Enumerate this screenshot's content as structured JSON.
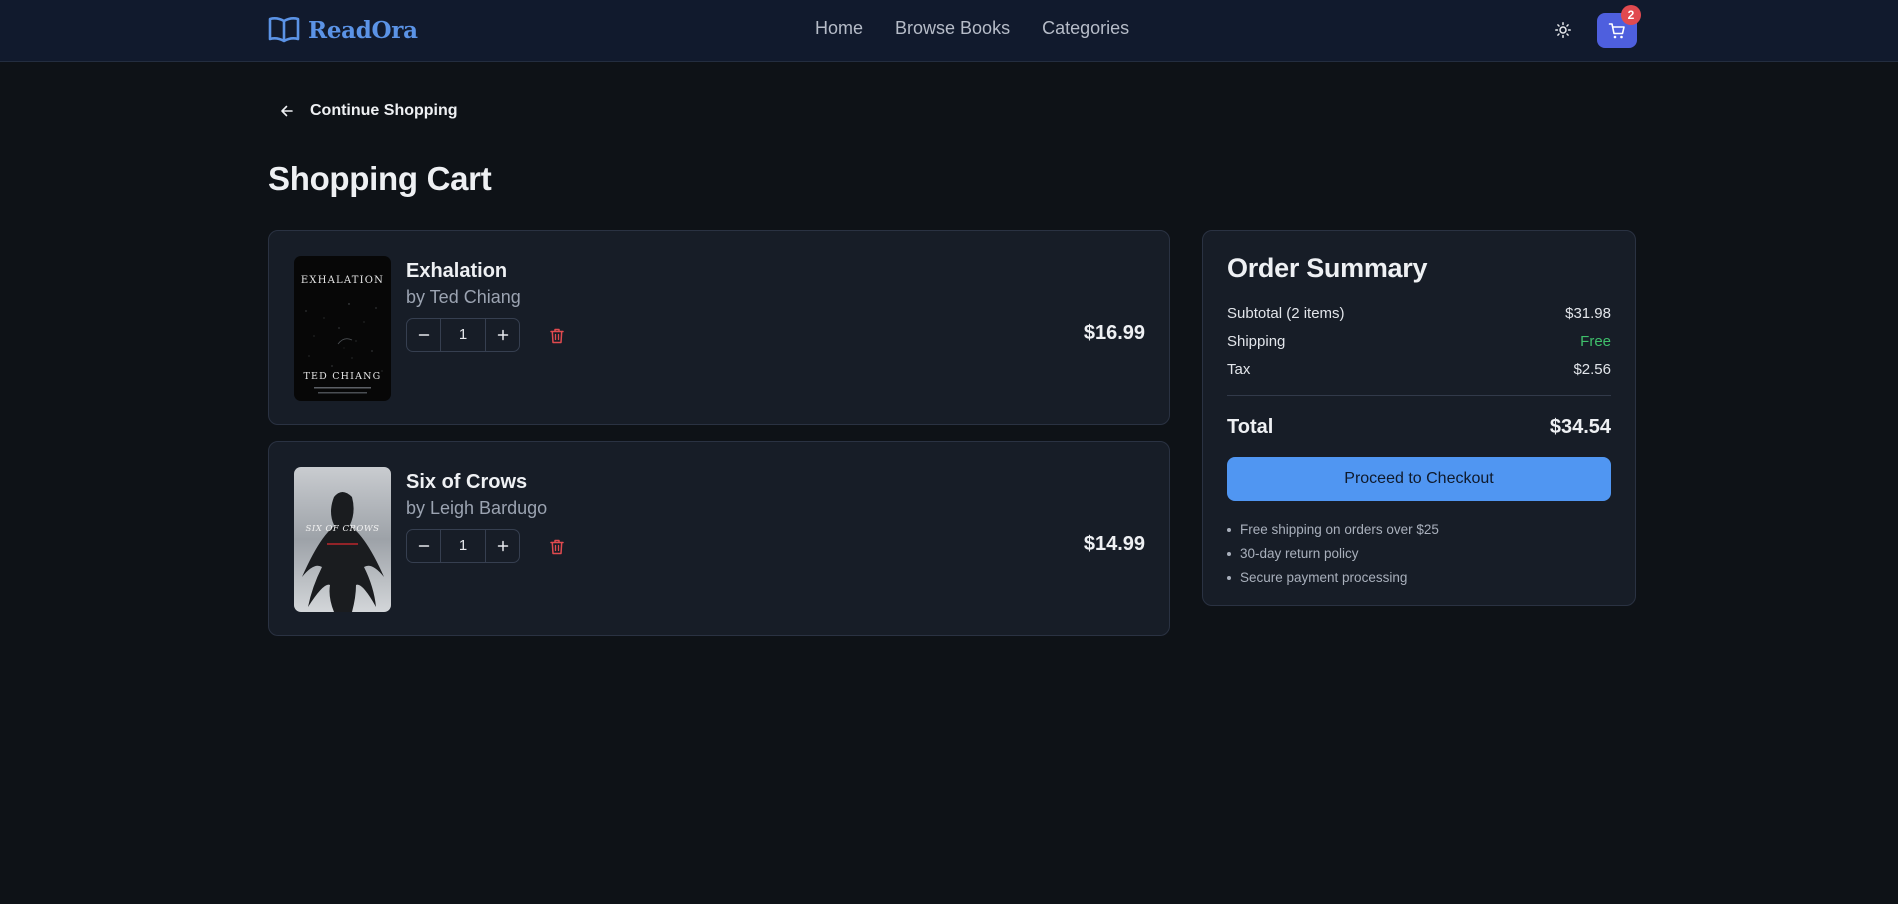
{
  "navbar": {
    "brand": "ReadOra",
    "links": [
      "Home",
      "Browse Books",
      "Categories"
    ],
    "cart_count": "2"
  },
  "back_link": "Continue Shopping",
  "page_title": "Shopping Cart",
  "items": [
    {
      "title": "Exhalation",
      "author": "by Ted Chiang",
      "quantity": "1",
      "price": "$16.99",
      "cover_title": "EXHALATION",
      "cover_author": "TED CHIANG"
    },
    {
      "title": "Six of Crows",
      "author": "by Leigh Bardugo",
      "quantity": "1",
      "price": "$14.99",
      "cover_title": "SIX OF CROWS"
    }
  ],
  "summary": {
    "title": "Order Summary",
    "subtotal_label": "Subtotal (2 items)",
    "subtotal_value": "$31.98",
    "shipping_label": "Shipping",
    "shipping_value": "Free",
    "tax_label": "Tax",
    "tax_value": "$2.56",
    "total_label": "Total",
    "total_value": "$34.54",
    "checkout_label": "Proceed to Checkout",
    "notes": [
      "Free shipping on orders over $25",
      "30-day return policy",
      "Secure payment processing"
    ]
  },
  "colors": {
    "accent": "#5096f2",
    "cart_button": "#4e5fde",
    "badge": "#e14a4f",
    "free_text": "#3fbf6b",
    "trash": "#e14a4f"
  },
  "icons": [
    "book-open-icon",
    "sun-icon",
    "cart-icon",
    "arrow-left-icon",
    "minus-icon",
    "plus-icon",
    "trash-icon"
  ]
}
